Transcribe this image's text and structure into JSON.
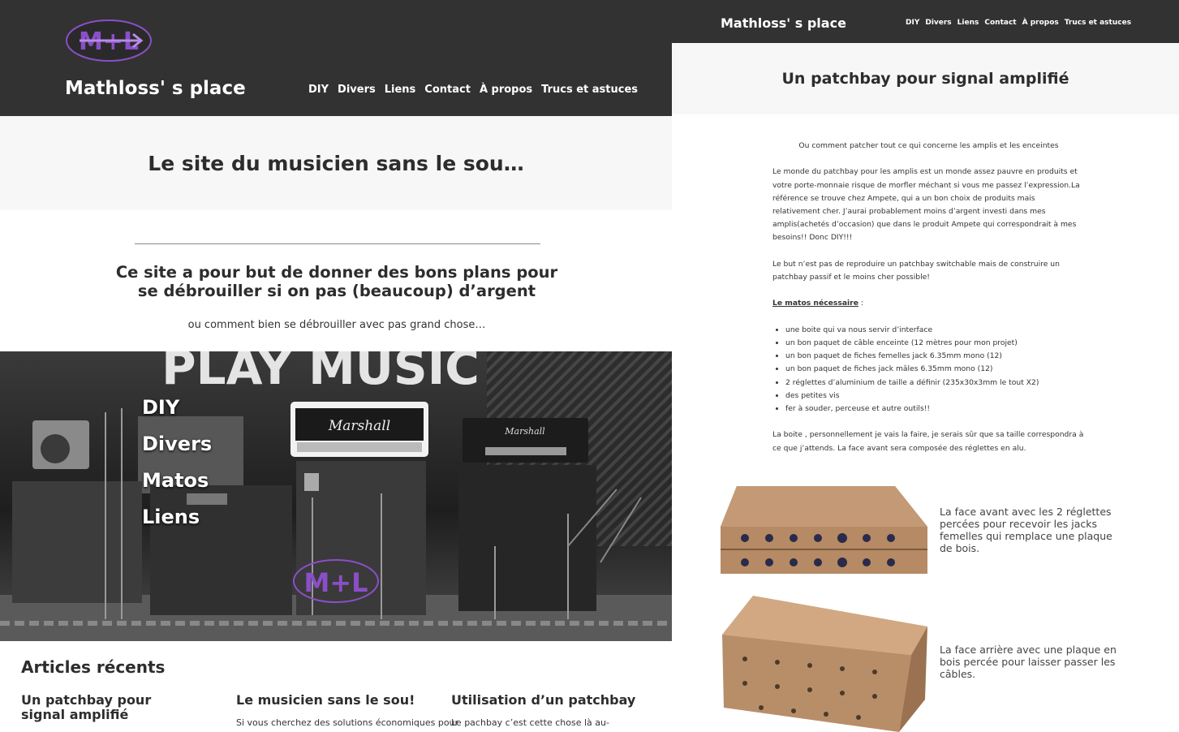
{
  "left": {
    "header": {
      "site_title": "Mathloss' s place",
      "nav": [
        "DIY",
        "Divers",
        "Liens",
        "Contact",
        "À propos",
        "Trucs et astuces"
      ]
    },
    "hero": {
      "heading": "Le site du musicien sans le sou…"
    },
    "intro": {
      "heading_line1": "Ce site a pour but de donner des bons plans pour",
      "heading_line2": "se débrouiller si on pas (beaucoup) d’argent",
      "subtitle": "ou comment bien se débrouiller avec pas grand chose…"
    },
    "stage": {
      "sign_text": "PLAY MUSIC",
      "amp_brand": "Marshall",
      "menu": [
        "DIY",
        "Divers",
        "Matos",
        "Liens"
      ]
    },
    "recent": {
      "heading": "Articles récents",
      "articles": [
        {
          "title_line1": "Un patchbay pour",
          "title_line2": "signal amplifié",
          "excerpt": ""
        },
        {
          "title_line1": "Le musicien sans le sou!",
          "title_line2": "",
          "excerpt": "Si vous cherchez des solutions économiques pour"
        },
        {
          "title_line1": "Utilisation d’un patchbay",
          "title_line2": "",
          "excerpt": "Le pachbay c’est cette chose là au-"
        }
      ]
    }
  },
  "right": {
    "header": {
      "site_title": "Mathloss' s place",
      "nav": [
        "DIY",
        "Divers",
        "Liens",
        "Contact",
        "À propos",
        "Trucs et astuces"
      ]
    },
    "title": "Un patchbay pour signal amplifié",
    "article": {
      "intro": "Ou comment patcher tout ce qui concerne les amplis et les enceintes",
      "p1": "Le monde du patchbay pour les amplis est un monde assez pauvre en produits et votre porte-monnaie risque de morfler méchant si vous me passez l’expression.La référence se trouve chez Ampete, qui a un bon choix de produits mais relativement cher. J’aurai probablement moins d’argent investi dans mes amplis(achetés d’occasion) que dans le produit Ampete qui correspondrait à mes besoins!! Donc DIY!!!",
      "p2": "Le but n’est pas de reproduire un patchbay switchable mais de construire un patchbay passif et le moins cher possible!",
      "matos_label": "Le matos nécessaire",
      "matos_suffix": " :",
      "items": [
        "une boite qui va nous servir d’interface",
        "un bon paquet de câble enceinte (12 mètres pour mon projet)",
        "un bon paquet de fiches femelles jack 6.35mm mono (12)",
        "un bon paquet de fiches jack mâles 6.35mm mono (12)",
        "2 réglettes d’aluminium de taille a définir (235x30x3mm le tout X2)",
        "des petites vis",
        "fer à souder, perceuse et autre outils!!"
      ],
      "p3": "La boite , personnellement je vais la faire, je serais sûr que sa taille correspondra à ce que j’attends. La face avant sera composée des réglettes en alu.",
      "captions": [
        "La face avant avec les 2 réglettes percées pour recevoir les jacks femelles qui remplace une plaque de bois.",
        "La face arrière avec une plaque en bois percée pour laisser passer les câbles."
      ]
    }
  },
  "colors": {
    "header_bg": "#323232",
    "band_bg": "#f7f7f7",
    "logo_purple": "#8a4fc7"
  }
}
